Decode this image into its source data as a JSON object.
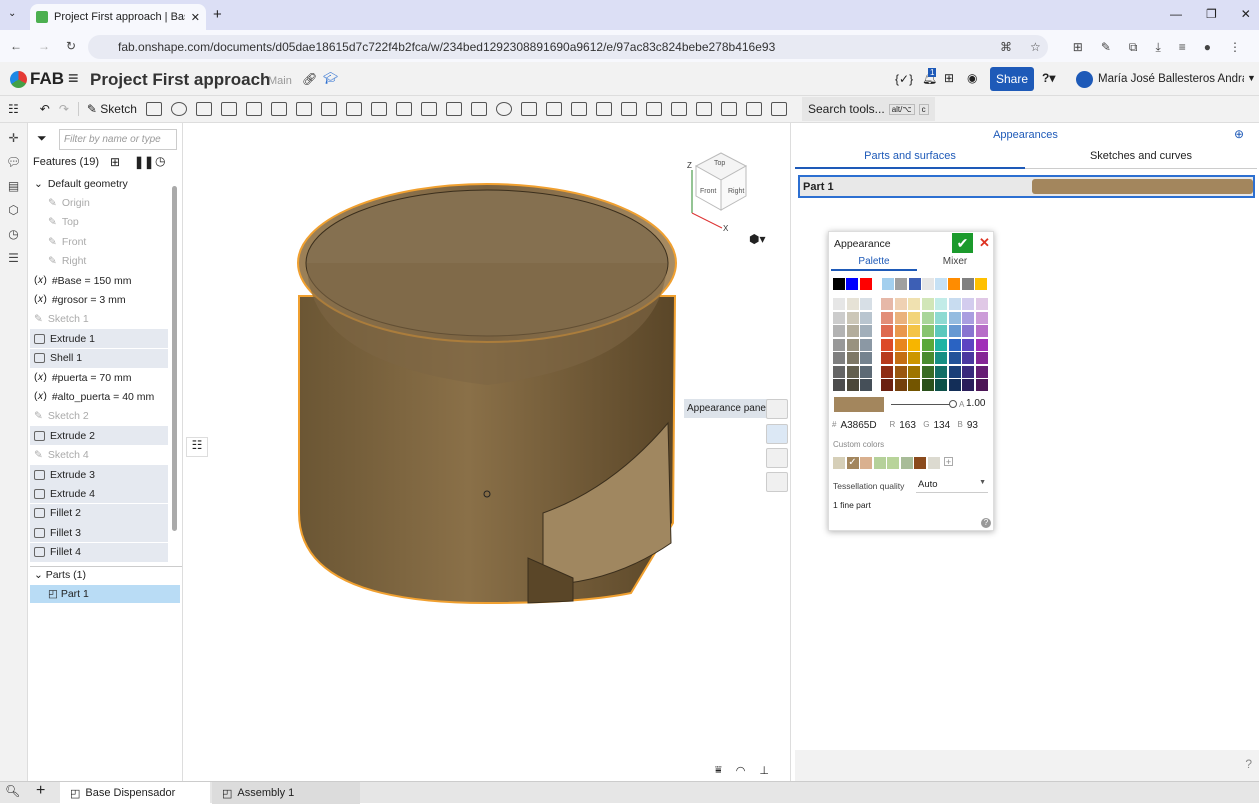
{
  "browser": {
    "tab_title": "Project First approach | Base Di",
    "url": "fab.onshape.com/documents/d05dae18615d7c722f4b2fca/w/234bed1292308891690a9612/e/97ac83c824bebe278b416e93"
  },
  "header": {
    "logo": "FAB",
    "title": "Project First approach",
    "branch": "Main",
    "notifications": "1",
    "share": "Share",
    "user": "María José Ballesteros Andraka",
    "variables_icon": "{✓}"
  },
  "toolbar": {
    "sketch": "Sketch",
    "search": "Search tools...",
    "shortcut1": "alt/⌥",
    "shortcut2": "c"
  },
  "features": {
    "filter_placeholder": "Filter by name or type",
    "title": "Features (19)",
    "items": [
      {
        "label": "Default geometry",
        "kind": "group"
      },
      {
        "label": "Origin",
        "kind": "dim"
      },
      {
        "label": "Top",
        "kind": "dim"
      },
      {
        "label": "Front",
        "kind": "dim"
      },
      {
        "label": "Right",
        "kind": "dim"
      },
      {
        "label": "#Base = 150 mm",
        "kind": "var"
      },
      {
        "label": "#grosor = 3 mm",
        "kind": "var"
      },
      {
        "label": "Sketch 1",
        "kind": "dim"
      },
      {
        "label": "Extrude 1",
        "kind": "sel"
      },
      {
        "label": "Shell 1",
        "kind": "sel"
      },
      {
        "label": "#puerta = 70 mm",
        "kind": "var"
      },
      {
        "label": "#alto_puerta = 40 mm",
        "kind": "var"
      },
      {
        "label": "Sketch 2",
        "kind": "dim"
      },
      {
        "label": "Extrude 2",
        "kind": "sel"
      },
      {
        "label": "Sketch 4",
        "kind": "dim"
      },
      {
        "label": "Extrude 3",
        "kind": "sel"
      },
      {
        "label": "Extrude 4",
        "kind": "sel"
      },
      {
        "label": "Fillet 2",
        "kind": "sel"
      },
      {
        "label": "Fillet 3",
        "kind": "sel"
      },
      {
        "label": "Fillet 4",
        "kind": "sel"
      }
    ],
    "parts_title": "Parts (1)",
    "part": "Part 1"
  },
  "viewcube": {
    "top": "Top",
    "front": "Front",
    "right": "Right",
    "x": "X",
    "z": "Z"
  },
  "viewport": {
    "tooltip": "Appearance panel"
  },
  "appearances": {
    "title": "Appearances",
    "tab1": "Parts and surfaces",
    "tab2": "Sketches and curves",
    "part": "Part 1",
    "part_color": "#A3865D"
  },
  "popup": {
    "title": "Appearance",
    "tab_palette": "Palette",
    "tab_mixer": "Mixer",
    "alpha_label": "A",
    "alpha": "1.00",
    "hex_label": "#",
    "hex": "A3865D",
    "r_label": "R",
    "r": "163",
    "g_label": "G",
    "g": "134",
    "b_label": "B",
    "b": "93",
    "custom_label": "Custom colors",
    "tess_label": "Tessellation quality",
    "tess": "Auto",
    "info": "1 fine part",
    "top_row": [
      "#000000",
      "#0000ff",
      "#ff0000",
      "#a3cfee",
      "#a0a0a0",
      "#3d5fb5",
      "#e6e6e6",
      "#c6e1f5",
      "#ff8c00",
      "#808080",
      "#ffc000"
    ],
    "grays": [
      [
        "#e6e6e6",
        "#e6e2d6",
        "#d7dfe6"
      ],
      [
        "#cccccc",
        "#ccc7b8",
        "#b9c5cf"
      ],
      [
        "#b3b3b3",
        "#b3ad9c",
        "#a2afba"
      ],
      [
        "#999999",
        "#99927f",
        "#8b98a4"
      ],
      [
        "#808080",
        "#7e7866",
        "#75838f"
      ],
      [
        "#666666",
        "#64604f",
        "#5d6a75"
      ],
      [
        "#4d4d4d",
        "#4b4739",
        "#454f58"
      ]
    ],
    "colors": [
      [
        "#e6b8a8",
        "#efd1b3",
        "#f0e1b0",
        "#d1e6b8",
        "#c2ece8",
        "#c8dcf0",
        "#d3ccee",
        "#e0c8e6"
      ],
      [
        "#e28e78",
        "#eab27c",
        "#f2d47a",
        "#a9d69a",
        "#8edad2",
        "#95bce0",
        "#a99ee0",
        "#cc9cd8"
      ],
      [
        "#de6a50",
        "#e9984d",
        "#f4c446",
        "#88c470",
        "#5cc8bd",
        "#6799d2",
        "#8875d0",
        "#b76ec8"
      ],
      [
        "#dc4a28",
        "#e8861e",
        "#f7b500",
        "#5aa83a",
        "#1eb3a4",
        "#2a63c2",
        "#5c45c2",
        "#a02eb8"
      ],
      [
        "#b83a1c",
        "#c46e14",
        "#cc9600",
        "#4a8c30",
        "#178f84",
        "#225299",
        "#4a38a0",
        "#852696"
      ],
      [
        "#8f2c14",
        "#9a560f",
        "#9e7400",
        "#396c25",
        "#126e66",
        "#1a3f78",
        "#39297c",
        "#661d74"
      ],
      [
        "#6b2010",
        "#733f0b",
        "#735500",
        "#2a501b",
        "#0d5049",
        "#132e58",
        "#2a1e5a",
        "#4c1556"
      ]
    ],
    "custom": [
      "#d6cfb8",
      "#a3865d",
      "#d9b08f",
      "#b5d19a",
      "#b8d49a",
      "#a8bc98",
      "#8a4a1c",
      "#dcdad0"
    ]
  },
  "bottom": {
    "tab1": "Base Dispensador",
    "tab2": "Assembly 1"
  }
}
